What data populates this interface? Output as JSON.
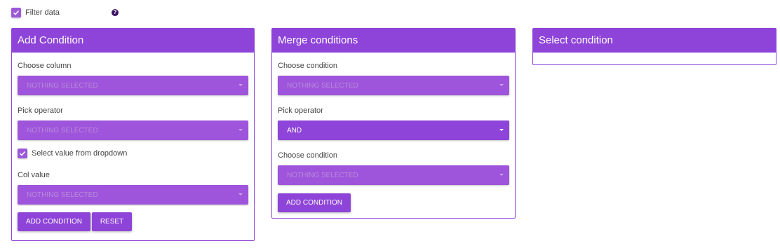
{
  "filter": {
    "label": "Filter data",
    "checked": true,
    "help_icon": "?"
  },
  "add_condition": {
    "title": "Add Condition",
    "choose_column_label": "Choose column",
    "choose_column_value": "NOTHING SELECTED",
    "pick_operator_label": "Pick operator",
    "pick_operator_value": "NOTHING SELECTED",
    "select_from_dropdown_label": "Select value from dropdown",
    "select_from_dropdown_checked": true,
    "col_value_label": "Col value",
    "col_value_value": "NOTHING SELECTED",
    "add_button": "ADD CONDITION",
    "reset_button": "RESET"
  },
  "merge_conditions": {
    "title": "Merge conditions",
    "choose_condition_1_label": "Choose condition",
    "choose_condition_1_value": "NOTHING SELECTED",
    "pick_operator_label": "Pick operator",
    "pick_operator_value": "AND",
    "choose_condition_2_label": "Choose condition",
    "choose_condition_2_value": "NOTHING SELECTED",
    "add_button": "ADD CONDITION"
  },
  "select_condition": {
    "title": "Select condition"
  },
  "colors": {
    "accent": "#8e44d8",
    "accent_light": "#9e55dc"
  }
}
